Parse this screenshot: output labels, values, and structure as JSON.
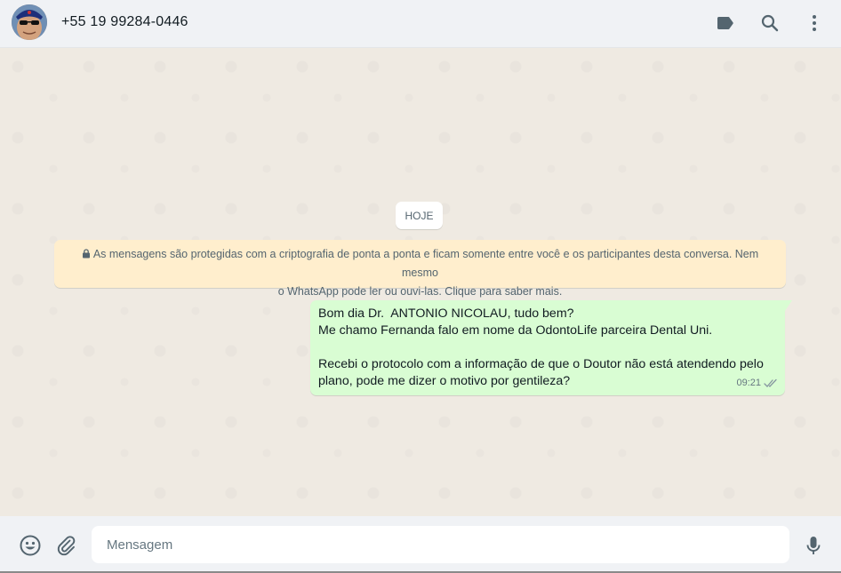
{
  "header": {
    "contact_name": "+55 19 99284-0446",
    "icons": [
      "label-icon",
      "search-icon",
      "menu-icon"
    ]
  },
  "chat": {
    "date_chip": "HOJE",
    "encryption_notice": "As mensagens são protegidas com a criptografia de ponta a ponta e ficam somente entre você e os participantes desta conversa. Nem mesmo o WhatsApp pode ler ou ouvi-las. Clique para saber mais.",
    "encryption_lines": [
      "As mensagens são protegidas com a criptografia de ponta a ponta e ficam somente entre você e os participantes desta conversa. Nem mesmo",
      "o WhatsApp pode ler ou ouvi-las. Clique para saber mais."
    ],
    "messages": [
      {
        "direction": "outgoing",
        "lines": [
          "Bom dia Dr.  ANTONIO NICOLAU, tudo bem?",
          "Me chamo Fernanda falo em nome da OdontoLife parceira Dental Uni.",
          "",
          "Recebi o protocolo com a informação de que o Doutor não está atendendo pelo",
          "plano, pode me dizer o motivo por gentileza?"
        ],
        "time": "09:21",
        "status": "delivered"
      }
    ]
  },
  "composer": {
    "placeholder": "Mensagem",
    "value": ""
  },
  "colors": {
    "header_bg": "#f0f2f5",
    "chat_bg": "#efeae2",
    "outgoing_bubble": "#d9fdd3",
    "encryption_bg": "#ffeecd",
    "icon": "#54656f"
  }
}
